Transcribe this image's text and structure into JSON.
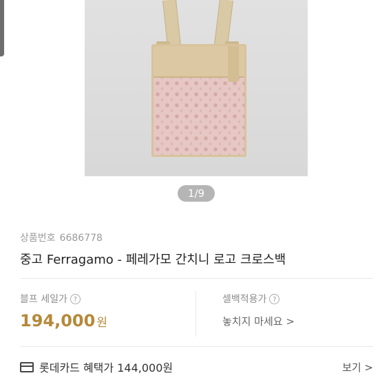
{
  "gallery": {
    "counter": "1/9",
    "image_alt": "Ferragamo crossbody bag photo"
  },
  "product": {
    "id_label": "상품번호",
    "id_value": "6686778",
    "title": "중고 Ferragamo - 페레가모 간치니 로고 크로스백"
  },
  "price_section": {
    "label": "블프 세일가",
    "price": "194,000",
    "currency": "원",
    "help_icon": "question-circle-icon"
  },
  "sell_section": {
    "label": "셀백적용가",
    "link_text": "놓치지 마세요 >",
    "help_icon": "question-circle-icon"
  },
  "card_benefit": {
    "icon": "credit-card-icon",
    "text": "롯데카드 혜택가 144,000원",
    "view_label": "보기 >"
  },
  "colors": {
    "price": "#b5893a",
    "counter_bg": "#b5b5b5"
  }
}
